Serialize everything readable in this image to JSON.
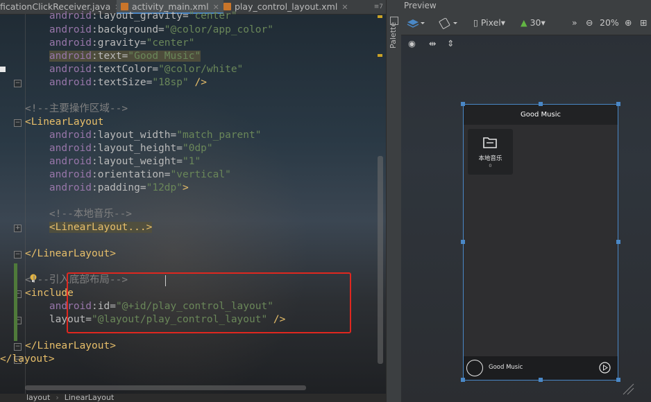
{
  "tabs": [
    {
      "label": "ficationClickReceiver.java",
      "active": false
    },
    {
      "label": "activity_main.xml",
      "active": true
    },
    {
      "label": "play_control_layout.xml",
      "active": false
    }
  ],
  "tab_overflow": "≡7",
  "code": {
    "l1_ns": "android",
    "l1_attr": ":layout_gravity=",
    "l1_val": "\"center\"",
    "l2_ns": "android",
    "l2_attr": ":background=",
    "l2_val": "\"@color/app_color\"",
    "l3_ns": "android",
    "l3_attr": ":gravity=",
    "l3_val": "\"center\"",
    "l4_ns": "android",
    "l4_attr": ":text=",
    "l4_val": "\"Good Music\"",
    "l5_ns": "android",
    "l5_attr": ":textColor=",
    "l5_val": "\"@color/white\"",
    "l6_ns": "android",
    "l6_attr": ":textSize=",
    "l6_val": "\"18sp\"",
    "l6_end": " />",
    "l7_comment": "<!--主要操作区域-->",
    "l8_tag": "<LinearLayout",
    "l9_ns": "android",
    "l9_attr": ":layout_width=",
    "l9_val": "\"match_parent\"",
    "l10_ns": "android",
    "l10_attr": ":layout_height=",
    "l10_val": "\"0dp\"",
    "l11_ns": "android",
    "l11_attr": ":layout_weight=",
    "l11_val": "\"1\"",
    "l12_ns": "android",
    "l12_attr": ":orientation=",
    "l12_val": "\"vertical\"",
    "l13_ns": "android",
    "l13_attr": ":padding=",
    "l13_val": "\"12dp\"",
    "l13_end": ">",
    "l14_comment": "<!--本地音乐-->",
    "l15_tag": "<LinearLayout...>",
    "l16_tag": "</LinearLayout>",
    "l17_comment": "<!--引入底部布局-->",
    "l18_tag": "<include",
    "l19_ns": "android",
    "l19_attr": ":id=",
    "l19_val": "\"@+id/play_control_layout\"",
    "l20_attr": "layout=",
    "l20_val": "\"@layout/play_control_layout\"",
    "l20_end": " />",
    "l21_tag": "</LinearLayout>",
    "l22_tag": "</layout>"
  },
  "breadcrumb": [
    "layout",
    "LinearLayout"
  ],
  "side_strip": {
    "palette": "Palette"
  },
  "preview": {
    "title": "Preview",
    "device": "Pixel",
    "api": "30",
    "zoom": "20%"
  },
  "phone": {
    "app_title": "Good Music",
    "local_music_label": "本地音乐",
    "local_music_count": "0",
    "control_title": "Good Music"
  },
  "colors": {
    "accent": "#4a88c7",
    "highlight_box": "#e0271f",
    "xml_tag": "#e8bf6a",
    "xml_value": "#6a8759",
    "xml_namespace": "#9876aa"
  }
}
